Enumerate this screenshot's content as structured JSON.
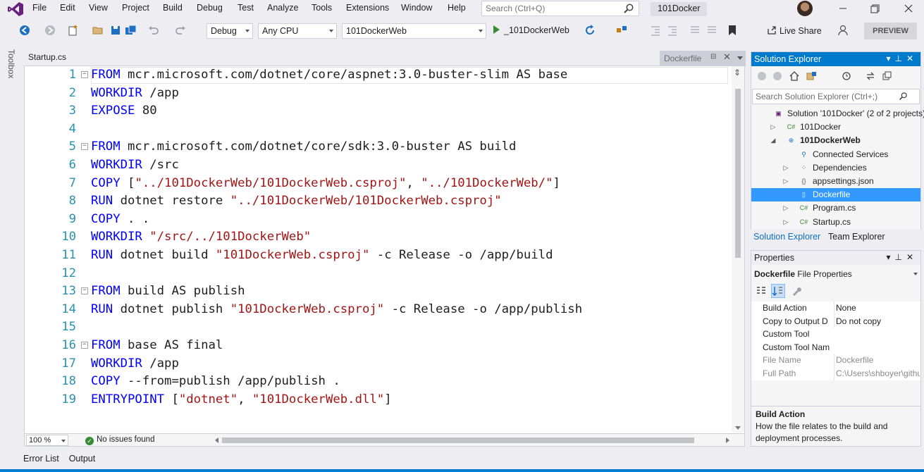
{
  "menu": [
    "File",
    "Edit",
    "View",
    "Project",
    "Build",
    "Debug",
    "Test",
    "Analyze",
    "Tools",
    "Extensions",
    "Window",
    "Help"
  ],
  "search": {
    "placeholder": "Search (Ctrl+Q)"
  },
  "solution_title": "101Docker",
  "toolbar": {
    "config": "Debug",
    "platform": "Any CPU",
    "startup_project": "101DockerWeb",
    "run_label": "_101DockerWeb",
    "live_share": "Live Share",
    "preview": "PREVIEW"
  },
  "toolbox_label": "Toolbox",
  "tabs": {
    "startup": "Startup.cs",
    "dockerfile": "Dockerfile"
  },
  "code_lines": [
    {
      "n": "1",
      "parts": [
        [
          "kw",
          "FROM"
        ],
        [
          "",
          " mcr.microsoft.com/dotnet/core/aspnet:3.0-buster-slim AS base"
        ]
      ]
    },
    {
      "n": "2",
      "parts": [
        [
          "kw",
          "WORKDIR"
        ],
        [
          "",
          " /app"
        ]
      ]
    },
    {
      "n": "3",
      "parts": [
        [
          "kw",
          "EXPOSE"
        ],
        [
          "",
          " 80"
        ]
      ]
    },
    {
      "n": "4",
      "parts": []
    },
    {
      "n": "5",
      "parts": [
        [
          "kw",
          "FROM"
        ],
        [
          "",
          " mcr.microsoft.com/dotnet/core/sdk:3.0-buster AS build"
        ]
      ]
    },
    {
      "n": "6",
      "parts": [
        [
          "kw",
          "WORKDIR"
        ],
        [
          "",
          " /src"
        ]
      ]
    },
    {
      "n": "7",
      "parts": [
        [
          "kw",
          "COPY"
        ],
        [
          "",
          " ["
        ],
        [
          "str",
          "\"../101DockerWeb/101DockerWeb.csproj\""
        ],
        [
          "",
          ", "
        ],
        [
          "str",
          "\"../101DockerWeb/\""
        ],
        [
          "",
          "]"
        ]
      ]
    },
    {
      "n": "8",
      "parts": [
        [
          "kw",
          "RUN"
        ],
        [
          "",
          " dotnet restore "
        ],
        [
          "str",
          "\"../101DockerWeb/101DockerWeb.csproj\""
        ]
      ]
    },
    {
      "n": "9",
      "parts": [
        [
          "kw",
          "COPY"
        ],
        [
          "",
          " . ."
        ]
      ]
    },
    {
      "n": "10",
      "parts": [
        [
          "kw",
          "WORKDIR"
        ],
        [
          "",
          " "
        ],
        [
          "str",
          "\"/src/../101DockerWeb\""
        ]
      ]
    },
    {
      "n": "11",
      "parts": [
        [
          "kw",
          "RUN"
        ],
        [
          "",
          " dotnet build "
        ],
        [
          "str",
          "\"101DockerWeb.csproj\""
        ],
        [
          "",
          " -c Release -o /app/build"
        ]
      ]
    },
    {
      "n": "12",
      "parts": []
    },
    {
      "n": "13",
      "parts": [
        [
          "kw",
          "FROM"
        ],
        [
          "",
          " build AS publish"
        ]
      ]
    },
    {
      "n": "14",
      "parts": [
        [
          "kw",
          "RUN"
        ],
        [
          "",
          " dotnet publish "
        ],
        [
          "str",
          "\"101DockerWeb.csproj\""
        ],
        [
          "",
          " -c Release -o /app/publish"
        ]
      ]
    },
    {
      "n": "15",
      "parts": []
    },
    {
      "n": "16",
      "parts": [
        [
          "kw",
          "FROM"
        ],
        [
          "",
          " base AS final"
        ]
      ]
    },
    {
      "n": "17",
      "parts": [
        [
          "kw",
          "WORKDIR"
        ],
        [
          "",
          " /app"
        ]
      ]
    },
    {
      "n": "18",
      "parts": [
        [
          "kw",
          "COPY"
        ],
        [
          "",
          " --from=publish /app/publish ."
        ]
      ]
    },
    {
      "n": "19",
      "parts": [
        [
          "kw",
          "ENTRYPOINT"
        ],
        [
          "",
          " ["
        ],
        [
          "str",
          "\"dotnet\""
        ],
        [
          "",
          ", "
        ],
        [
          "str",
          "\"101DockerWeb.dll\""
        ],
        [
          "",
          "]"
        ]
      ]
    }
  ],
  "fold_lines": [
    "1",
    "5",
    "13",
    "16"
  ],
  "editor_status": {
    "zoom": "100 %",
    "issues": "No issues found"
  },
  "bottom_tabs": [
    "Error List",
    "Output"
  ],
  "solution_explorer": {
    "title": "Solution Explorer",
    "search_placeholder": "Search Solution Explorer (Ctrl+;)",
    "tree": [
      {
        "label": "Solution '101Docker' (2 of 2 projects)",
        "depth": 0,
        "expander": "",
        "icon": "solution-icon",
        "bold": false,
        "selected": false
      },
      {
        "label": "101Docker",
        "depth": 1,
        "expander": "collapsed",
        "icon": "csharp-project-icon",
        "bold": false,
        "selected": false
      },
      {
        "label": "101DockerWeb",
        "depth": 1,
        "expander": "expanded",
        "icon": "web-project-icon",
        "bold": true,
        "selected": false
      },
      {
        "label": "Connected Services",
        "depth": 2,
        "expander": "",
        "icon": "connected-services-icon",
        "bold": false,
        "selected": false
      },
      {
        "label": "Dependencies",
        "depth": 2,
        "expander": "collapsed",
        "icon": "dependencies-icon",
        "bold": false,
        "selected": false
      },
      {
        "label": "appsettings.json",
        "depth": 2,
        "expander": "collapsed",
        "icon": "json-file-icon",
        "bold": false,
        "selected": false
      },
      {
        "label": "Dockerfile",
        "depth": 2,
        "expander": "",
        "icon": "file-icon",
        "bold": false,
        "selected": true
      },
      {
        "label": "Program.cs",
        "depth": 2,
        "expander": "collapsed",
        "icon": "csharp-file-icon",
        "bold": false,
        "selected": false
      },
      {
        "label": "Startup.cs",
        "depth": 2,
        "expander": "collapsed",
        "icon": "csharp-file-icon",
        "bold": false,
        "selected": false
      }
    ],
    "tabs": [
      "Solution Explorer",
      "Team Explorer"
    ]
  },
  "properties": {
    "title": "Properties",
    "object_name": "Dockerfile",
    "object_type": "File Properties",
    "rows": [
      {
        "key": "Build Action",
        "value": "None",
        "dim": false
      },
      {
        "key": "Copy to Output D",
        "value": "Do not copy",
        "dim": false
      },
      {
        "key": "Custom Tool",
        "value": "",
        "dim": false
      },
      {
        "key": "Custom Tool Nam",
        "value": "",
        "dim": false
      },
      {
        "key": "File Name",
        "value": "Dockerfile",
        "dim": true
      },
      {
        "key": "Full Path",
        "value": "C:\\Users\\shboyer\\githu",
        "dim": true
      }
    ],
    "desc_title": "Build Action",
    "desc_text": "How the file relates to the build and deployment processes."
  },
  "colors": {
    "accent": "#007acc",
    "keyword": "#0000ff",
    "string": "#a31515",
    "line_number": "#2b91af",
    "selection": "#3399ff"
  }
}
